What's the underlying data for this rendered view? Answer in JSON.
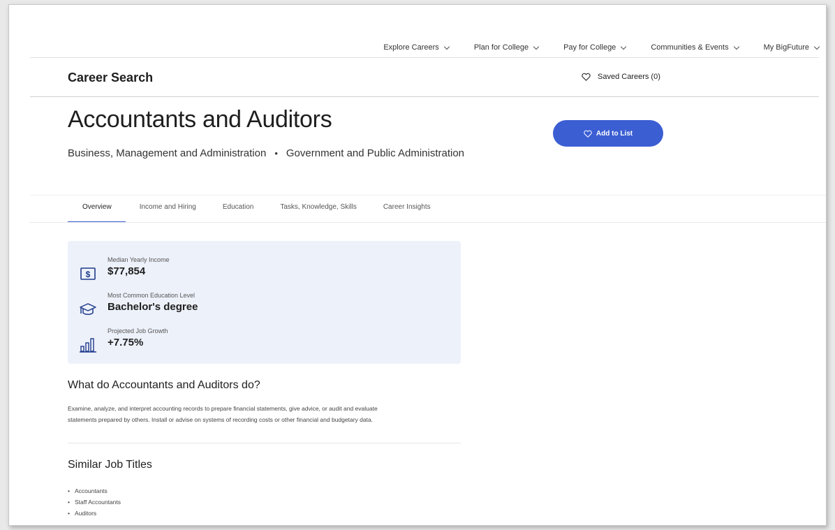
{
  "nav": {
    "items": [
      {
        "label": "Explore Careers"
      },
      {
        "label": "Plan for College"
      },
      {
        "label": "Pay for College"
      },
      {
        "label": "Communities & Events"
      },
      {
        "label": "My BigFuture"
      }
    ]
  },
  "subheader": {
    "title": "Career Search",
    "saved_label": "Saved Careers (0)"
  },
  "career": {
    "title": "Accountants and Auditors",
    "clusters": [
      "Business, Management and Administration",
      "Government and Public Administration"
    ],
    "separator": "•",
    "add_button": "Add to List"
  },
  "tabs": [
    {
      "label": "Overview",
      "active": true
    },
    {
      "label": "Income and Hiring"
    },
    {
      "label": "Education"
    },
    {
      "label": "Tasks, Knowledge, Skills"
    },
    {
      "label": "Career Insights"
    }
  ],
  "summary": {
    "income": {
      "label": "Median Yearly Income",
      "value": "$77,854",
      "icon": "dollar-icon"
    },
    "education": {
      "label": "Most Common Education Level",
      "value": "Bachelor's degree",
      "icon": "graduation-cap-icon"
    },
    "growth": {
      "label": "Projected Job Growth",
      "value": "+7.75%",
      "icon": "bar-chart-icon"
    }
  },
  "what_do": {
    "heading": "What do Accountants and Auditors do?",
    "line1": "Examine, analyze, and interpret accounting records to prepare financial statements, give advice, or audit and evaluate",
    "line2": "statements prepared by others. Install or advise on systems of recording costs or other financial and budgetary data."
  },
  "similar": {
    "heading": "Similar Job Titles",
    "items": [
      "Accountants",
      "Staff Accountants",
      "Auditors"
    ]
  },
  "colors": {
    "accent": "#3b5ed3",
    "summary_bg": "#edf1fa"
  }
}
